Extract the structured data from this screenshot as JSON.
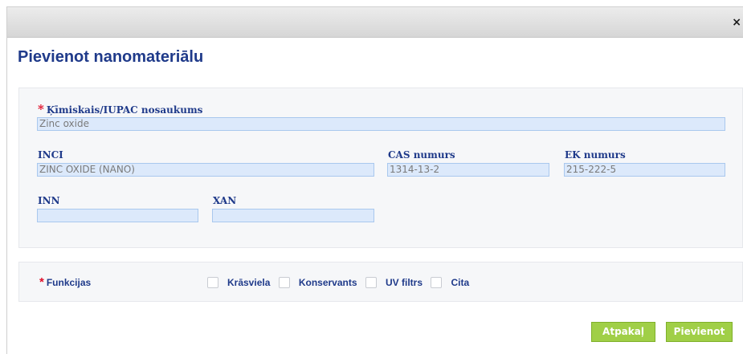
{
  "dialog": {
    "close_symbol": "×",
    "title": "Pievienot nanomateriālu"
  },
  "fields": {
    "chemical_name": {
      "label": "Ķīmiskais/IUPAC nosaukums",
      "value": "Zinc oxide"
    },
    "inci": {
      "label": "INCI",
      "value": "ZINC OXIDE (NANO)"
    },
    "cas": {
      "label": "CAS numurs",
      "value": "1314-13-2"
    },
    "ek": {
      "label": "EK numurs",
      "value": "215-222-5"
    },
    "inn": {
      "label": "INN",
      "value": ""
    },
    "xan": {
      "label": "XAN",
      "value": ""
    }
  },
  "functions": {
    "label": "Funkcijas",
    "options": [
      "Krāsviela",
      "Konservants",
      "UV filtrs",
      "Cita"
    ]
  },
  "buttons": {
    "back": "Atpakaļ",
    "add": "Pievienot"
  },
  "required_marker": "*"
}
